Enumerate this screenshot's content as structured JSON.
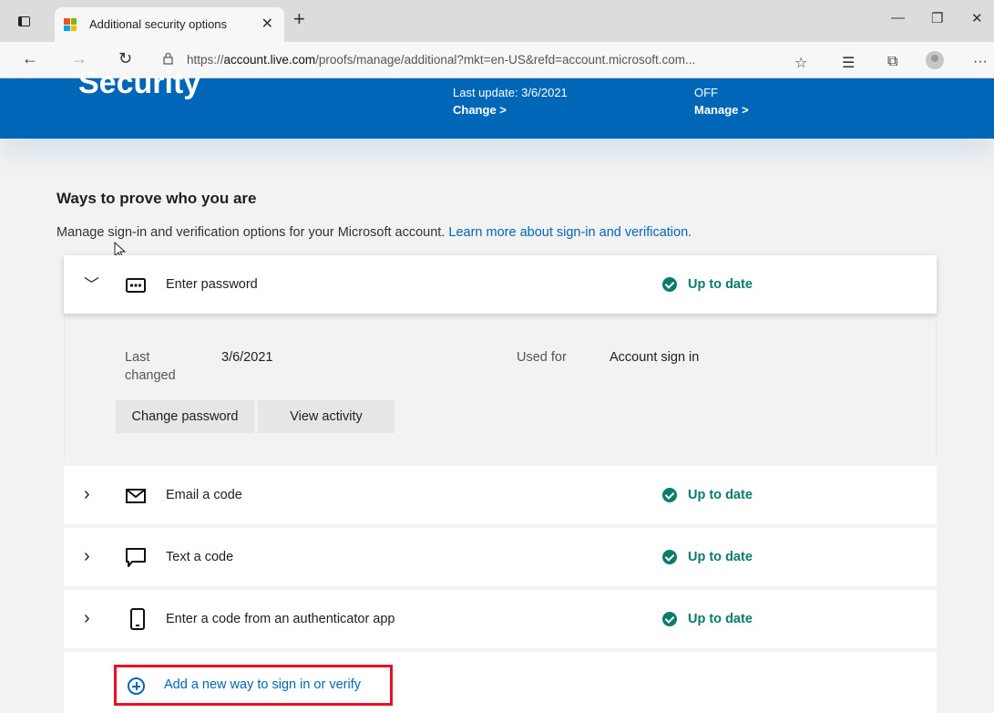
{
  "browser": {
    "tab_title": "Additional security options",
    "url_prefix": "https://",
    "url_host": "account.live.com",
    "url_rest": "/proofs/manage/additional?mkt=en-US&refd=account.microsoft.com..."
  },
  "banner": {
    "title": "Security",
    "col1": {
      "text": "Last update: 3/6/2021",
      "link": "Change >"
    },
    "col2": {
      "text": "OFF",
      "link": "Manage >"
    }
  },
  "section": {
    "title": "Ways to prove who you are",
    "description": "Manage sign-in and verification options for your Microsoft account.",
    "learn_more": "Learn more about sign-in and verification."
  },
  "methods": [
    {
      "label": "Enter password",
      "status": "Up to date",
      "icon": "password-dots-icon",
      "expanded": true
    },
    {
      "label": "Email a code",
      "status": "Up to date",
      "icon": "envelope-icon",
      "expanded": false
    },
    {
      "label": "Text a code",
      "status": "Up to date",
      "icon": "chat-bubble-icon",
      "expanded": false
    },
    {
      "label": "Enter a code from an authenticator app",
      "status": "Up to date",
      "icon": "phone-icon",
      "expanded": false
    }
  ],
  "password_details": {
    "last_changed_label": "Last changed",
    "last_changed_value": "3/6/2021",
    "used_for_label": "Used for",
    "used_for_value": "Account sign in",
    "change_password": "Change password",
    "view_activity": "View activity"
  },
  "add_method": {
    "label": "Add a new way to sign in or verify"
  },
  "colors": {
    "brand_blue": "#0067b8",
    "status_green": "#0b7c6b",
    "highlight_red": "#e81123"
  }
}
